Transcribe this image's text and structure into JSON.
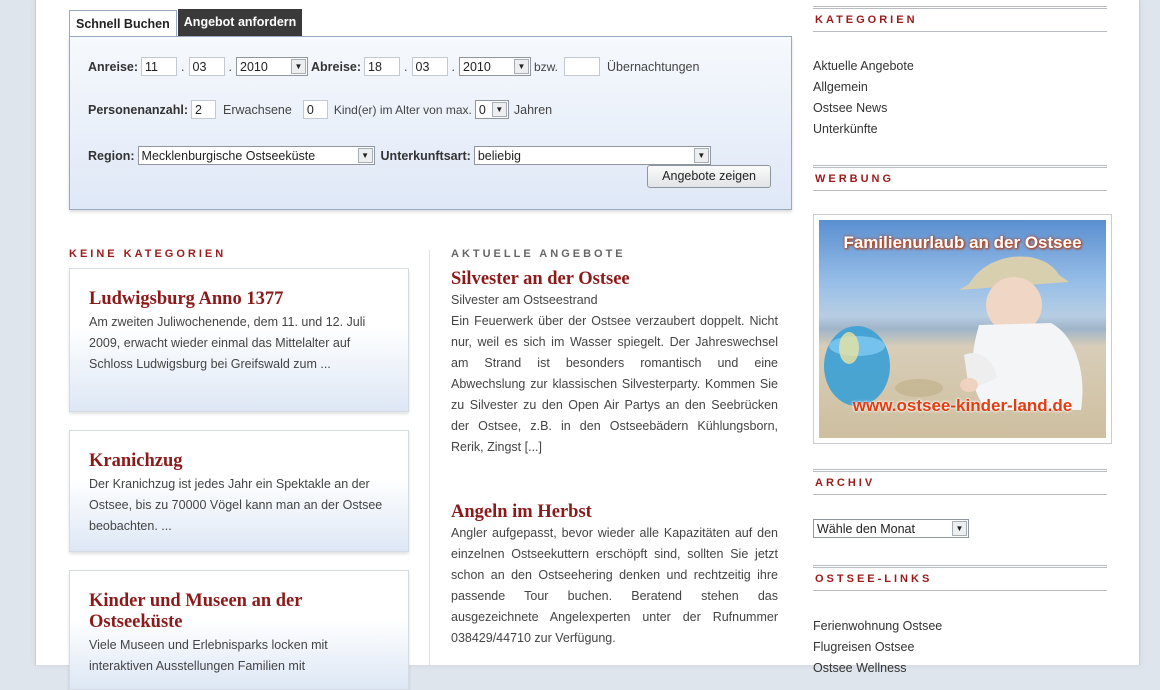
{
  "booking": {
    "tabs": [
      "Schnell Buchen",
      "Angebot anfordern"
    ],
    "arrival_label": "Anreise:",
    "arrival_day": "11",
    "arrival_month": "03",
    "arrival_year": "2010",
    "departure_label": "Abreise:",
    "departure_day": "18",
    "departure_month": "03",
    "departure_year": "2010",
    "or_label": "bzw.",
    "nights_value": "",
    "nights_label": "Übernachtungen",
    "persons_label": "Personenanzahl:",
    "adults_value": "2",
    "adults_label": "Erwachsene",
    "children_value": "0",
    "children_label": "Kind(er) im Alter von max.",
    "age_value": "0",
    "years_label": "Jahren",
    "region_label": "Region:",
    "region_value": "Mecklenburgische Ostseeküste",
    "type_label": "Unterkunftsart:",
    "type_value": "beliebig",
    "submit_label": "Angebote zeigen"
  },
  "left": {
    "heading": "KEINE KATEGORIEN",
    "cards": [
      {
        "title": "Ludwigsburg Anno 1377",
        "text": "Am zweiten Juliwochenende, dem 11. und 12. Juli 2009, erwacht wieder einmal das Mittelalter auf Schloss Ludwigsburg bei Greifswald zum ..."
      },
      {
        "title": "Kranichzug",
        "text": "Der Kranichzug ist jedes Jahr ein Spektakle an der Ostsee, bis zu 70000 Vögel kann man an der Ostsee beobachten. ..."
      },
      {
        "title": "Kinder und Museen an der Ostseeküste",
        "text": "Viele Museen und Erlebnisparks locken mit interaktiven Ausstellungen Familien mit"
      }
    ]
  },
  "middle": {
    "heading": "AKTUELLE ANGEBOTE",
    "posts": [
      {
        "title": "Silvester an der Ostsee",
        "subtitle": "Silvester am Ostseestrand",
        "text": "Ein Feuerwerk über der Ostsee verzaubert doppelt. Nicht nur, weil es sich im Wasser spiegelt. Der Jahreswechsel am Strand ist besonders romantisch und eine Abwechslung zur klassischen Silvesterparty. Kommen Sie zu Silvester zu den Open Air Partys an den Seebrücken der Ostsee, z.B. in den Ostseebädern Kühlungsborn, Rerik, Zingst [...]"
      },
      {
        "title": "Angeln im Herbst",
        "subtitle": "",
        "text": "Angler aufgepasst, bevor wieder alle Kapazitäten auf den einzelnen Ostseekuttern erschöpft sind, sollten Sie jetzt schon an den Ostseehering denken und rechtzeitig ihre passende Tour buchen. Beratend stehen das ausgezeichnete Angelexperten unter der Rufnummer 038429/44710 zur Verfügung."
      }
    ]
  },
  "sidebar": {
    "categories_heading": "KATEGORIEN",
    "categories": [
      "Aktuelle Angebote",
      "Allgemein",
      "Ostsee News",
      "Unterkünfte"
    ],
    "ads_heading": "WERBUNG",
    "ad_title": "Familienurlaub an der Ostsee",
    "ad_url": "www.ostsee-kinder-land.de",
    "archive_heading": "ARCHIV",
    "archive_select": "Wähle den Monat",
    "links_heading": "OSTSEE-LINKS",
    "links": [
      "Ferienwohnung Ostsee",
      "Flugreisen Ostsee",
      "Ostsee Wellness"
    ]
  }
}
